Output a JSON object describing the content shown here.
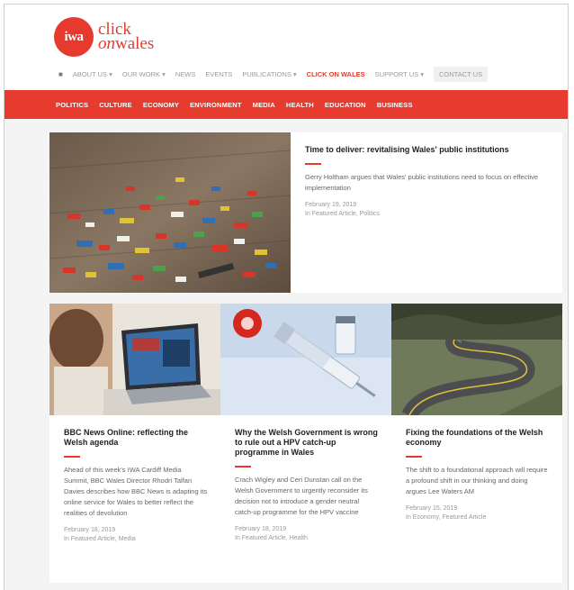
{
  "brand": {
    "logo_mark": "iwa",
    "name_line1": "click",
    "name_line2_italic": "on",
    "name_line2": "wales",
    "accent_color": "#e63a2e"
  },
  "topnav": {
    "home_icon": "home-icon",
    "items": [
      "ABOUT US ▾",
      "OUR WORK ▾",
      "NEWS",
      "EVENTS",
      "PUBLICATIONS ▾",
      "CLICK ON WALES",
      "SUPPORT US ▾"
    ],
    "contact": "CONTACT US"
  },
  "categories": [
    "POLITICS",
    "CULTURE",
    "ECONOMY",
    "ENVIRONMENT",
    "MEDIA",
    "HEALTH",
    "EDUCATION",
    "BUSINESS"
  ],
  "featured": {
    "title": "Time to deliver: revitalising Wales' public institutions",
    "excerpt": "Gerry Holtham argues that Wales' public institutions need to focus on effective implementation",
    "date": "February 19, 2019",
    "category": "In Featured Article, Politics"
  },
  "cards": [
    {
      "title": "BBC News Online: reflecting the Welsh agenda",
      "excerpt": "Ahead of this week's IWA Cardiff Media Summit, BBC Wales Director Rhodri Talfan Davies describes how BBC News is adapting its online service for Wales to better reflect the realities of devolution",
      "date": "February 18, 2019",
      "category": "In Featured Article, Media"
    },
    {
      "title": "Why the Welsh Government is wrong to rule out a HPV catch-up programme in Wales",
      "excerpt": "Crach Wigley and Ceri Dunstan call on the Welsh Government to urgently reconsider its decision not to introduce a gender neutral catch-up programme for the HPV vaccine",
      "date": "February 18, 2019",
      "category": "In Featured Article, Health"
    },
    {
      "title": "Fixing the foundations of the Welsh economy",
      "excerpt": "The shift to a foundational approach will require a profound shift in our thinking and doing argues Lee Waters AM",
      "date": "February 15, 2019",
      "category": "In Economy, Featured Article"
    }
  ]
}
